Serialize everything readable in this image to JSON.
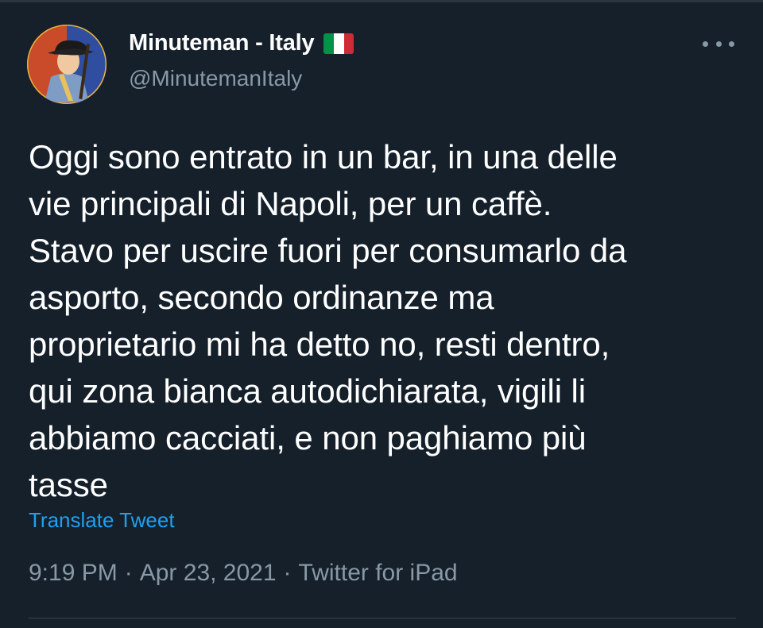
{
  "author": {
    "display_name": "Minuteman - Italy",
    "handle": "@MinutemanItaly",
    "flag": [
      "#009246",
      "#ffffff",
      "#ce2b37"
    ]
  },
  "tweet": {
    "text": "Oggi sono entrato in un bar, in una delle\nvie principali di Napoli, per un caffè.\nStavo per uscire fuori per consumarlo da\nasporto, secondo ordinanze ma\nproprietario mi ha detto no, resti dentro,\nqui zona bianca autodichiarata, vigili li\nabbiamo cacciati, e non paghiamo più\ntasse",
    "translate_label": "Translate Tweet",
    "time": "9:19 PM",
    "date": "Apr 23, 2021",
    "source": "Twitter for iPad",
    "separator": "·"
  },
  "icons": {
    "more": "more-horizontal-icon",
    "flag": "italy-flag-icon",
    "avatar": "minuteman-avatar"
  },
  "colors": {
    "background": "#15202b",
    "text": "#ffffff",
    "muted": "#8899a6",
    "link": "#1da1f2",
    "divider": "#38444d"
  }
}
